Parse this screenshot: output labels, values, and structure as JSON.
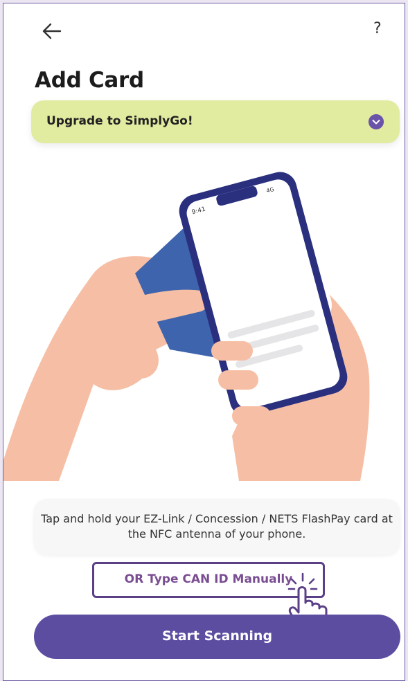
{
  "header": {
    "back_icon": "arrow-left-icon",
    "help_label": "?",
    "title": "Add Card"
  },
  "banner": {
    "label": "Upgrade to SimplyGo!",
    "icon": "chevron-down-icon",
    "background": "#e2eca0",
    "icon_color": "#6a54a9"
  },
  "illustration": {
    "phone_time": "9:41",
    "phone_signal": "4G",
    "card_color": "#3e64ad",
    "phone_frame_color": "#2a2f7e",
    "skin_color": "#f6bfa5"
  },
  "instructions": {
    "text": "Tap and hold your EZ-Link / Concession / NETS FlashPay card at the NFC antenna of your phone."
  },
  "manual_entry": {
    "label": "OR Type CAN ID Manually",
    "icon": "tap-hand-icon",
    "highlight_color": "#5b3f87"
  },
  "primary_action": {
    "label": "Start Scanning",
    "color": "#5c4da1"
  }
}
